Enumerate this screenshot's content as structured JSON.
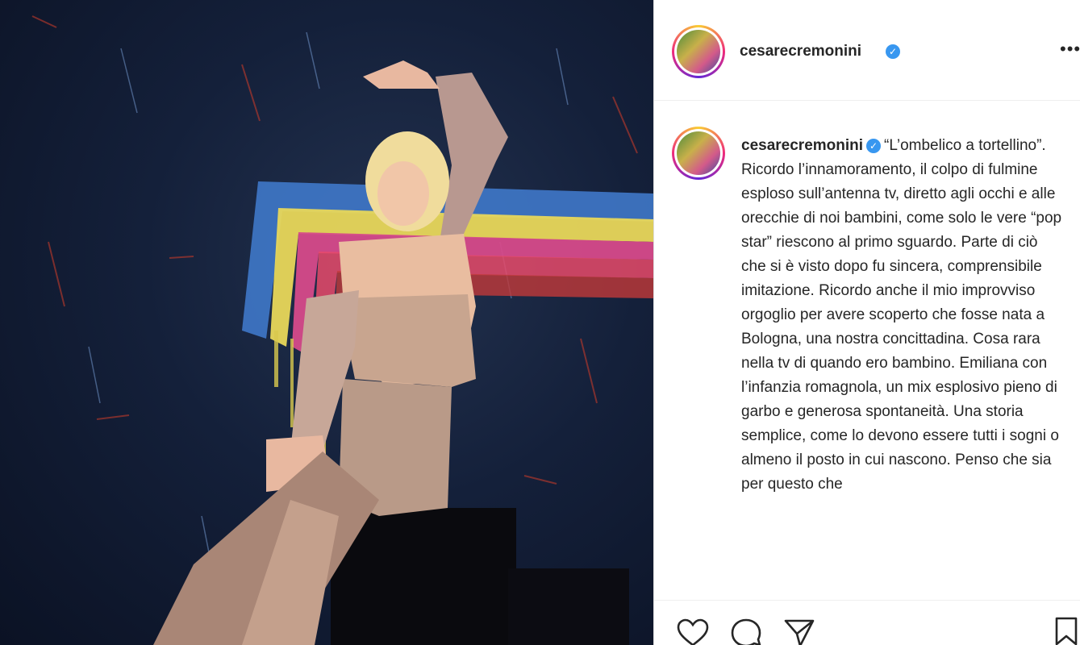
{
  "post": {
    "username": "cesarecremonini",
    "verified_icon": "verified-badge-icon",
    "more_label": "•••",
    "caption": "“L’ombelico a tortellino”. Ricordo l’innamoramento, il colpo di fulmine esploso sull’antenna tv, diretto agli occhi e alle orecchie di noi bambini, come solo le vere “pop star” riescono al primo sguardo. Parte di ciò che si è visto dopo fu sincera, comprensibile imitazione. Ricordo anche il mio improvviso orgoglio per avere scoperto che fosse nata a Bologna, una nostra concittadina. Cosa rara nella tv di quando ero bambino. Emiliana con l’infanzia romagnola, un mix esplosivo pieno di garbo e generosa spontaneità. Una storia semplice, come lo devono essere tutti i sogni o almeno il posto in cui nascono. Penso che sia per questo che"
  },
  "actions": {
    "icons": [
      "heart-icon",
      "comment-icon",
      "share-icon",
      "bookmark-icon"
    ]
  },
  "colors": {
    "verified": "#3897f0",
    "text": "#262626",
    "border": "#dbdbdb"
  }
}
